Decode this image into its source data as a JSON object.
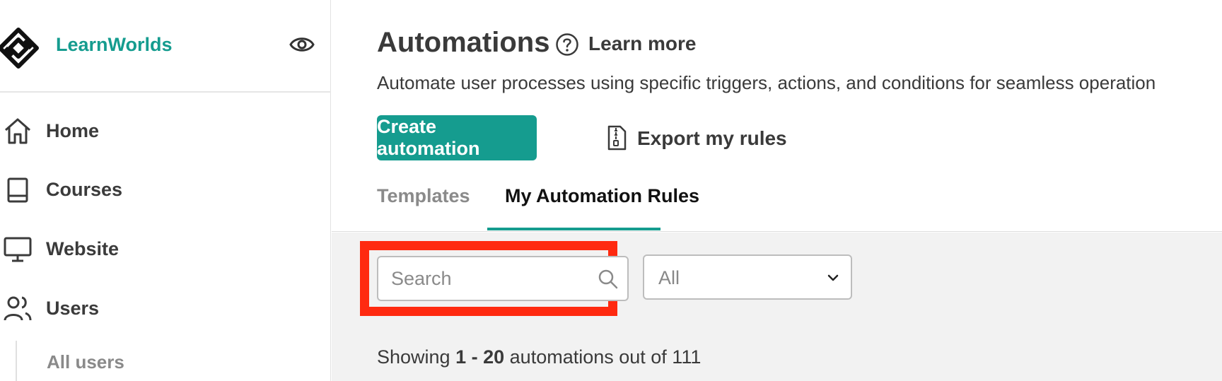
{
  "brand": {
    "name": "LearnWorlds"
  },
  "sidebar": {
    "items": [
      {
        "label": "Home",
        "icon": "home-icon"
      },
      {
        "label": "Courses",
        "icon": "book-icon"
      },
      {
        "label": "Website",
        "icon": "monitor-icon"
      },
      {
        "label": "Users",
        "icon": "users-icon"
      }
    ],
    "subitems": [
      {
        "label": "All users"
      }
    ]
  },
  "header": {
    "title": "Automations",
    "learn_more": "Learn more",
    "subtitle": "Automate user processes using specific triggers, actions, and conditions for seamless operation"
  },
  "actions": {
    "create_label": "Create automation",
    "export_label": "Export my rules"
  },
  "tabs": [
    {
      "label": "Templates",
      "active": false
    },
    {
      "label": "My Automation Rules",
      "active": true
    }
  ],
  "filters": {
    "search_placeholder": "Search",
    "search_value": "",
    "select_value": "All"
  },
  "results": {
    "prefix": "Showing",
    "range": "1 - 20",
    "suffix": "automations out of 111"
  },
  "colors": {
    "accent": "#159c8f",
    "highlight": "#ff2a10"
  }
}
